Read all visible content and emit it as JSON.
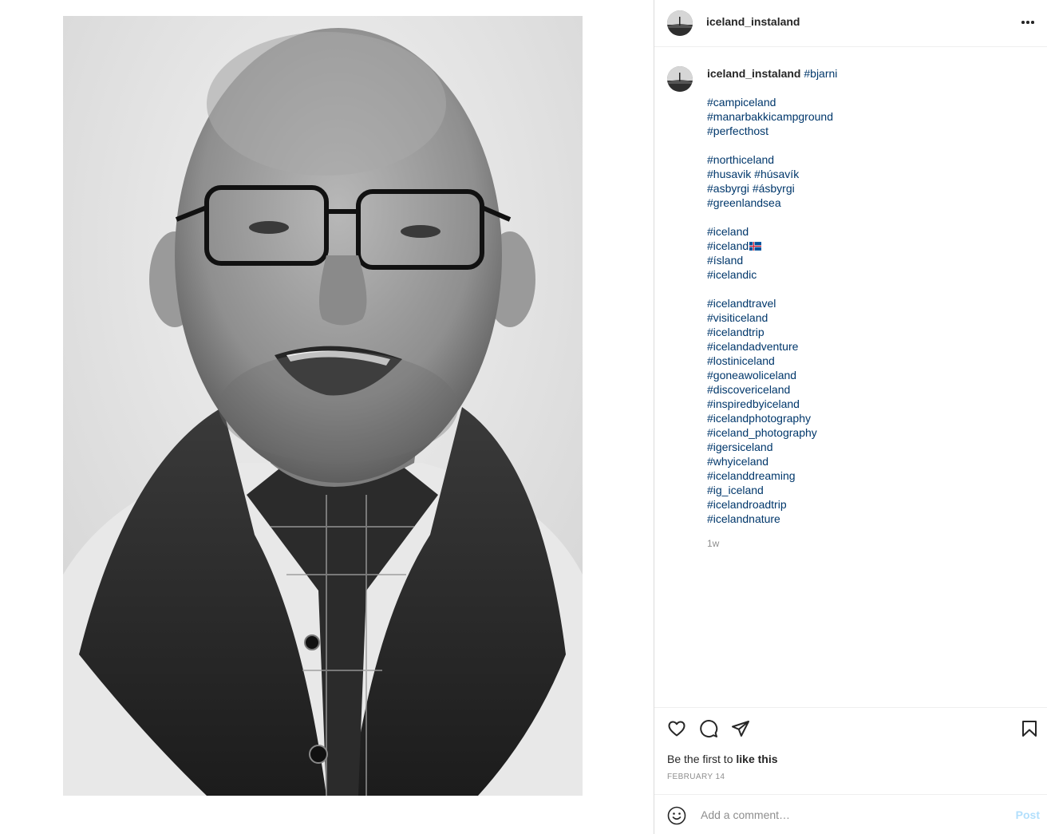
{
  "header": {
    "username": "iceland_instaland"
  },
  "caption": {
    "username": "iceland_instaland",
    "first_tag": "#bjarni",
    "groups": [
      [
        "#campiceland",
        "#manarbakkicampground",
        "#perfecthost"
      ],
      [
        "#northiceland",
        "#husavik #húsavík",
        "#asbyrgi #ásbyrgi",
        "#greenlandsea"
      ],
      [
        "#iceland",
        "#iceland🇮🇸",
        "#ísland",
        "#icelandic"
      ],
      [
        "#icelandtravel",
        "#visiticeland",
        "#icelandtrip",
        "#icelandadventure",
        "#lostiniceland",
        "#goneawoliceland",
        "#discovericeland",
        "#inspiredbyiceland",
        "#icelandphotography",
        "#iceland_photography",
        "#igersiceland",
        "#whyiceland",
        "#icelanddreaming",
        "#ig_iceland",
        "#icelandroadtrip",
        "#icelandnature"
      ]
    ],
    "relative_time": "1w"
  },
  "actions": {
    "icons": [
      "heart-icon",
      "comment-icon",
      "share-icon",
      "bookmark-icon"
    ],
    "likes_prefix": "Be the first to ",
    "likes_link": "like this",
    "date": "FEBRUARY 14"
  },
  "comment": {
    "placeholder": "Add a comment…",
    "post_label": "Post"
  },
  "colors": {
    "hashtag": "#00376b",
    "post_disabled": "#b2dffc",
    "muted": "#8e8e8e"
  }
}
